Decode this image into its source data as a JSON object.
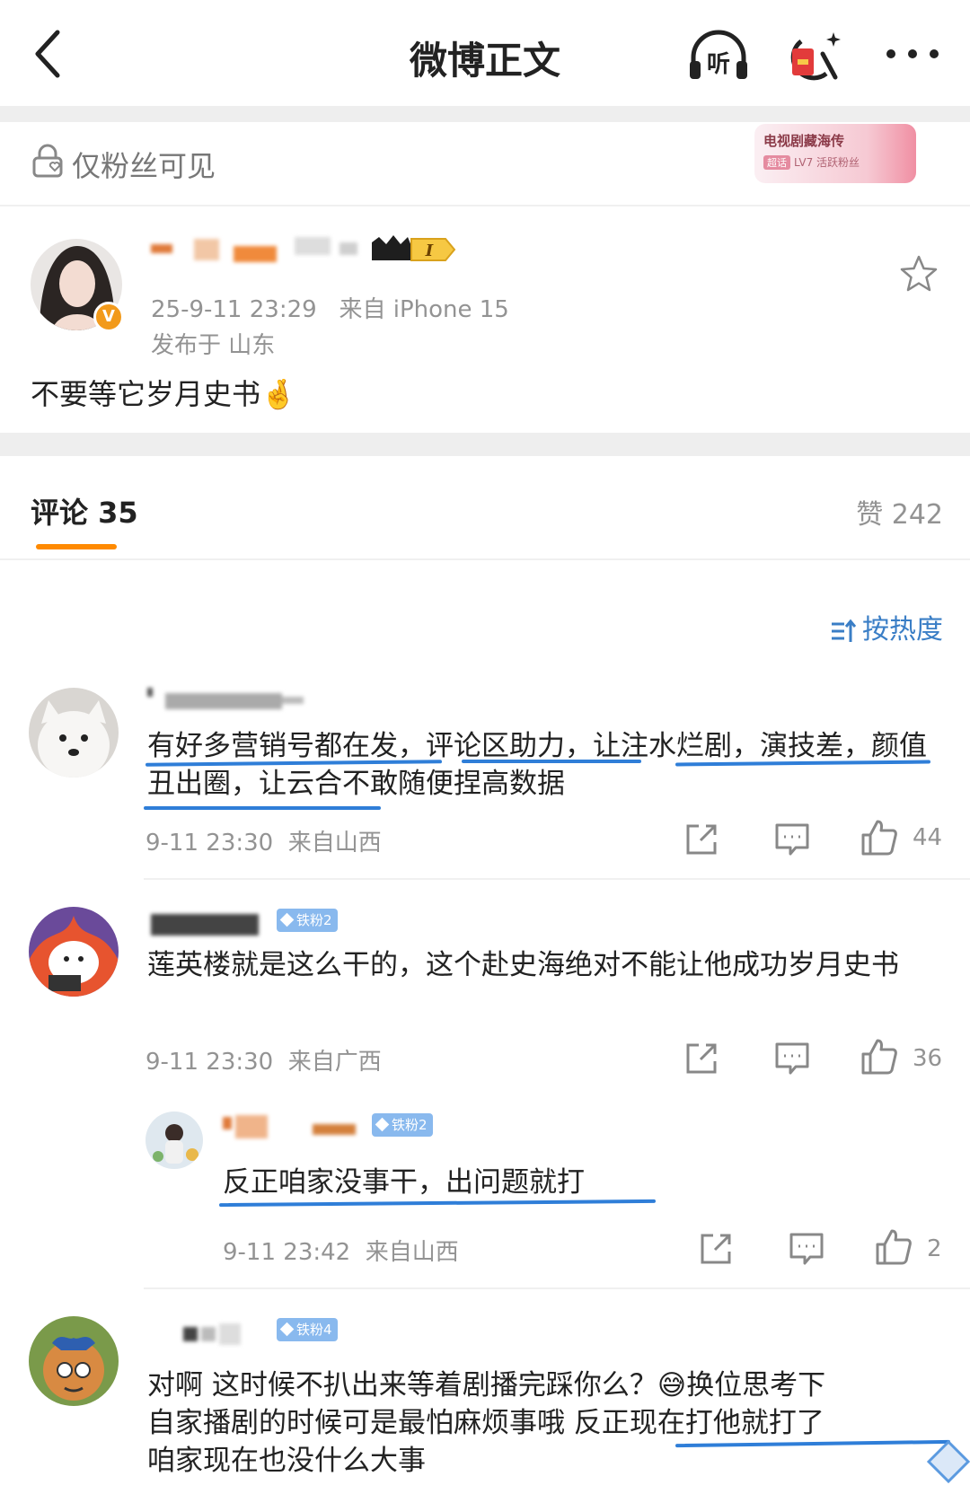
{
  "nav": {
    "title": "微博正文",
    "icons": [
      "back-arrow-icon",
      "listen-icon",
      "red-envelope-icon",
      "more-icon"
    ],
    "listen_label": "听"
  },
  "visibility": {
    "label": "仅粉丝可见"
  },
  "fan_badge": {
    "title": "电视剧藏海传",
    "level_tag": "超话",
    "level_text": "LV7 活跃粉丝"
  },
  "post": {
    "avatar_badge": "V",
    "vip_level": "I",
    "time": "25-9-11 23:29",
    "source": "来自 iPhone 15",
    "location": "发布于 山东",
    "content": "不要等它岁月史书",
    "emoji": "🤞"
  },
  "tabs": {
    "comments_label": "评论 35",
    "likes_label": "赞 242"
  },
  "sort": {
    "label": "按热度"
  },
  "comments": [
    {
      "text": "有好多营销号都在发，评论区助力，让注水烂剧，演技差，颜值丑出圈，让云合不敢随便捏高数据",
      "time": "9-11 23:30",
      "location": "来自山西",
      "likes": "44"
    },
    {
      "badge": "铁粉2",
      "text": "莲英楼就是这么干的，这个赴史海绝对不能让他成功岁月史书",
      "time": "9-11 23:30",
      "location": "来自广西",
      "likes": "36",
      "reply": {
        "badge": "铁粉2",
        "text": "反正咱家没事干，出问题就打",
        "time": "9-11 23:42",
        "location": "来自山西",
        "likes": "2"
      }
    },
    {
      "badge": "铁粉4",
      "text_line1": "对啊 这时候不扒出来等着剧播完踩你么？",
      "emoji": "😅",
      "text_line1b": "换位思考下",
      "text_line2": "自家播剧的时候可是最怕麻烦事哦 反正现在打他就打了",
      "text_line3": "咱家现在也没什么大事"
    }
  ],
  "colors": {
    "accent": "#ff8a00",
    "link": "#3a7ec6",
    "underline": "#2f7ed8",
    "muted": "#939393"
  }
}
